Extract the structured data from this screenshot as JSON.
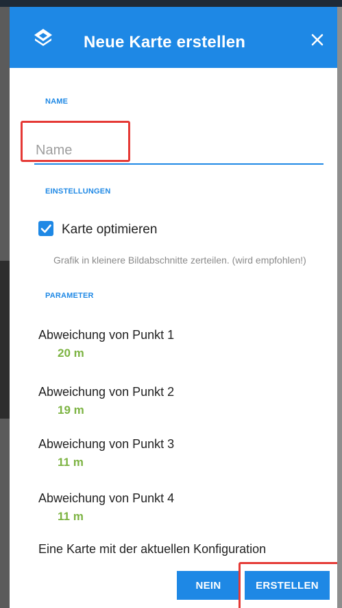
{
  "dialog": {
    "title": "Neue Karte erstellen",
    "logo_icon": "locus-logo-icon",
    "close_icon": "close-icon"
  },
  "name_section": {
    "label": "NAME",
    "placeholder": "Name",
    "value": ""
  },
  "settings_section": {
    "label": "EINSTELLUNGEN",
    "optimize_checkbox": {
      "label": "Karte optimieren",
      "checked": true,
      "hint": "Grafik in kleinere Bildabschnitte zerteilen. (wird empfohlen!)"
    }
  },
  "parameter_section": {
    "label": "PARAMETER",
    "items": [
      {
        "label": "Abweichung von Punkt 1",
        "value": "20 m"
      },
      {
        "label": "Abweichung von Punkt 2",
        "value": "19 m"
      },
      {
        "label": "Abweichung von Punkt 3",
        "value": "11 m"
      },
      {
        "label": "Abweichung von Punkt 4",
        "value": "11 m"
      }
    ]
  },
  "info_text": "Eine Karte mit der aktuellen Konfiguration",
  "buttons": {
    "no_label": "NEIN",
    "create_label": "ERSTELLEN"
  },
  "colors": {
    "accent": "#1e88e5",
    "value_green": "#7cb342",
    "highlight_red": "#e53935"
  }
}
